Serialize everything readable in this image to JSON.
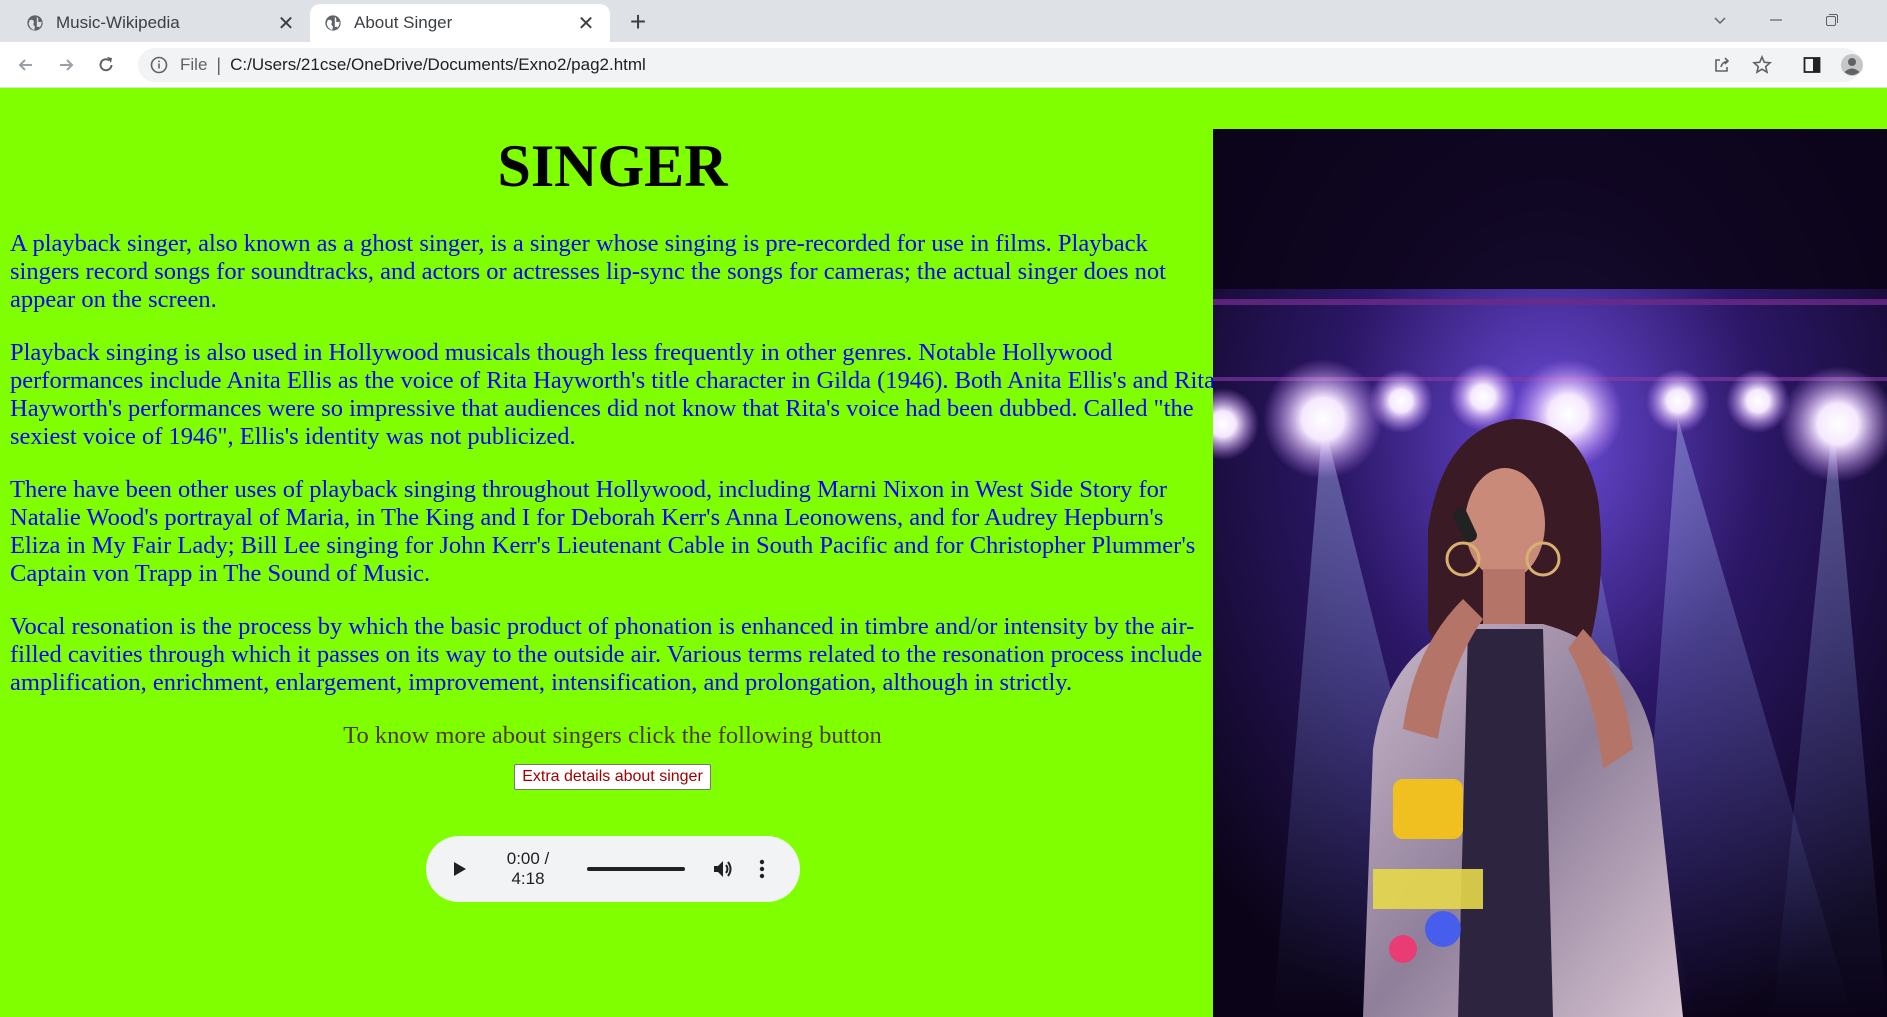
{
  "browser": {
    "tabs": [
      {
        "title": "Music-Wikipedia",
        "active": false
      },
      {
        "title": "About Singer",
        "active": true
      }
    ],
    "address": {
      "scheme_label": "File",
      "url": "C:/Users/21cse/OneDrive/Documents/Exno2/pag2.html"
    },
    "icons": [
      "globe-icon",
      "close-icon",
      "plus-icon",
      "chevron-down-icon",
      "minimize-icon",
      "restore-icon",
      "back-icon",
      "forward-icon",
      "reload-icon",
      "info-icon",
      "share-icon",
      "star-icon",
      "side-panel-icon",
      "profile-icon"
    ]
  },
  "page": {
    "background": "#80ff00",
    "heading": "SINGER",
    "paragraphs": [
      "A playback singer, also known as a ghost singer, is a singer whose singing is pre-recorded for use in films. Playback singers record songs for soundtracks, and actors or actresses lip-sync the songs for cameras; the actual singer does not appear on the screen.",
      "Playback singing is also used in Hollywood musicals though less frequently in other genres. Notable Hollywood performances include Anita Ellis as the voice of Rita Hayworth's title character in Gilda (1946). Both Anita Ellis's and Rita Hayworth's performances were so impressive that audiences did not know that Rita's voice had been dubbed. Called \"the sexiest voice of 1946\", Ellis's identity was not publicized.",
      "There have been other uses of playback singing throughout Hollywood, including Marni Nixon in West Side Story for Natalie Wood's portrayal of Maria, in The King and I for Deborah Kerr's Anna Leonowens, and for Audrey Hepburn's Eliza in My Fair Lady; Bill Lee singing for John Kerr's Lieutenant Cable in South Pacific and for Christopher Plummer's Captain von Trapp in The Sound of Music.",
      "Vocal resonation is the process by which the basic product of phonation is enhanced in timbre and/or intensity by the air-filled cavities through which it passes on its way to the outside air. Various terms related to the resonation process include amplification, enrichment, enlargement, improvement, intensification, and prolongation, although in strictly."
    ],
    "prompt": "To know more about singers click the following button",
    "button_label": "Extra details about singer",
    "audio": {
      "time": "0:00 / 4:18",
      "progress": 0
    }
  }
}
